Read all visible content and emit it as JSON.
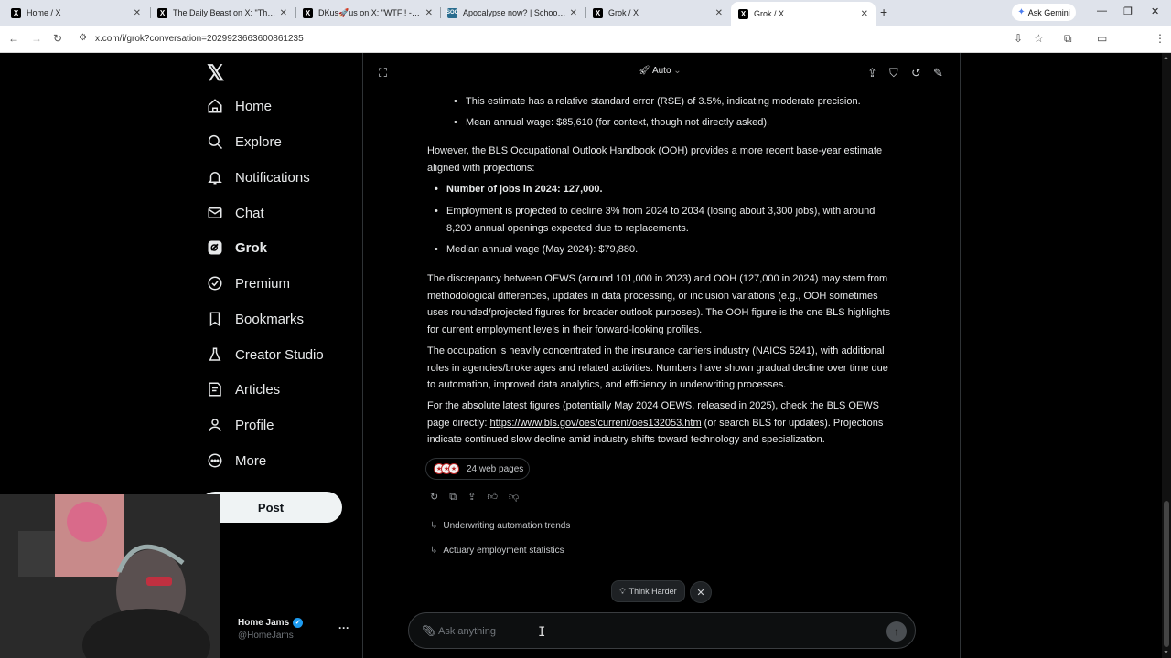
{
  "browser": {
    "tabs": [
      {
        "title": "Home / X",
        "icon": "X"
      },
      {
        "title": "The Daily Beast on X: \"The fam",
        "icon": "X"
      },
      {
        "title": "DKus🚀us on X: \"WTF!! - Welco",
        "icon": "X"
      },
      {
        "title": "Apocalypse now? | School of Sc",
        "icon": "SOC"
      },
      {
        "title": "Grok / X",
        "icon": "X"
      },
      {
        "title": "Grok / X",
        "icon": "X"
      }
    ],
    "new_tab": "+",
    "ask_gemini": "Ask Gemini",
    "url": "x.com/i/grok?conversation=2029923663600861235"
  },
  "sidebar": {
    "logo": "𝕏",
    "items": [
      {
        "label": "Home",
        "icon": "home-icon"
      },
      {
        "label": "Explore",
        "icon": "search-icon"
      },
      {
        "label": "Notifications",
        "icon": "bell-icon"
      },
      {
        "label": "Chat",
        "icon": "mail-icon"
      },
      {
        "label": "Grok",
        "icon": "grok-icon"
      },
      {
        "label": "Premium",
        "icon": "premium-icon"
      },
      {
        "label": "Bookmarks",
        "icon": "bookmark-icon"
      },
      {
        "label": "Creator Studio",
        "icon": "flask-icon"
      },
      {
        "label": "Articles",
        "icon": "articles-icon"
      },
      {
        "label": "Profile",
        "icon": "person-icon"
      },
      {
        "label": "More",
        "icon": "more-circle-icon"
      }
    ],
    "post_label": "Post",
    "user": {
      "name": "Home Jams",
      "handle": "@HomeJams"
    }
  },
  "grok": {
    "mode": "Auto",
    "bullets_top": [
      "This estimate has a relative standard error (RSE) of 3.5%, indicating moderate precision.",
      "Mean annual wage: $85,610 (for context, though not directly asked)."
    ],
    "para1": "However, the BLS Occupational Outlook Handbook (OOH) provides a more recent base-year estimate aligned with projections:",
    "bullets_mid": [
      "Number of jobs in 2024: 127,000.",
      "Employment is projected to decline 3% from 2024 to 2034 (losing about 3,300 jobs), with around 8,200 annual openings expected due to replacements.",
      "Median annual wage (May 2024): $79,880."
    ],
    "para2": "The discrepancy between OEWS (around 101,000 in 2023) and OOH (127,000 in 2024) may stem from methodological differences, updates in data processing, or inclusion variations (e.g., OOH sometimes uses rounded/projected figures for broader outlook purposes). The OOH figure is the one BLS highlights for current employment levels in their forward-looking profiles.",
    "para3": "The occupation is heavily concentrated in the insurance carriers industry (NAICS 5241), with additional roles in agencies/brokerages and related activities. Numbers have shown gradual decline over time due to automation, improved data analytics, and efficiency in underwriting processes.",
    "para4_pre": "For the absolute latest figures (potentially May 2024 OEWS, released in 2025), check the BLS OEWS page directly: ",
    "para4_link": "https://www.bls.gov/oes/current/oes132053.htm",
    "para4_post": " (or search BLS for updates). Projections indicate continued slow decline amid industry shifts toward technology and specialization.",
    "sources_label": "24 web pages",
    "followups": [
      "Underwriting automation trends",
      "Actuary employment statistics"
    ],
    "think_harder": "Think Harder",
    "input_placeholder": "Ask anything"
  }
}
